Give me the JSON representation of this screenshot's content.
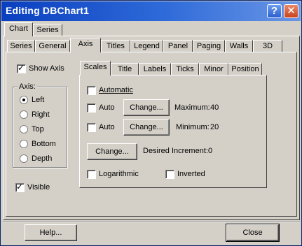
{
  "window": {
    "title": "Editing DBChart1",
    "help_glyph": "?",
    "close_glyph": "✕"
  },
  "top_tabs": [
    "Chart",
    "Series"
  ],
  "chart_tabs": [
    "Series",
    "General",
    "Axis",
    "Titles",
    "Legend",
    "Panel",
    "Paging",
    "Walls",
    "3D"
  ],
  "axis": {
    "show_axis": "Show Axis",
    "group_label": "Axis:",
    "options": [
      "Left",
      "Right",
      "Top",
      "Bottom",
      "Depth"
    ],
    "visible": "Visible"
  },
  "inner_tabs": [
    "Scales",
    "Title",
    "Labels",
    "Ticks",
    "Minor",
    "Position"
  ],
  "scales": {
    "automatic": "Automatic",
    "auto_label": "Auto",
    "change_label": "Change...",
    "maximum_label": "Maximum:",
    "maximum_value": "40",
    "minimum_label": "Minimum:",
    "minimum_value": "20",
    "desired_increment_label": "Desired Increment:",
    "desired_increment_value": "0",
    "logarithmic": "Logarithmic",
    "inverted": "Inverted"
  },
  "footer": {
    "help": "Help...",
    "close": "Close"
  }
}
